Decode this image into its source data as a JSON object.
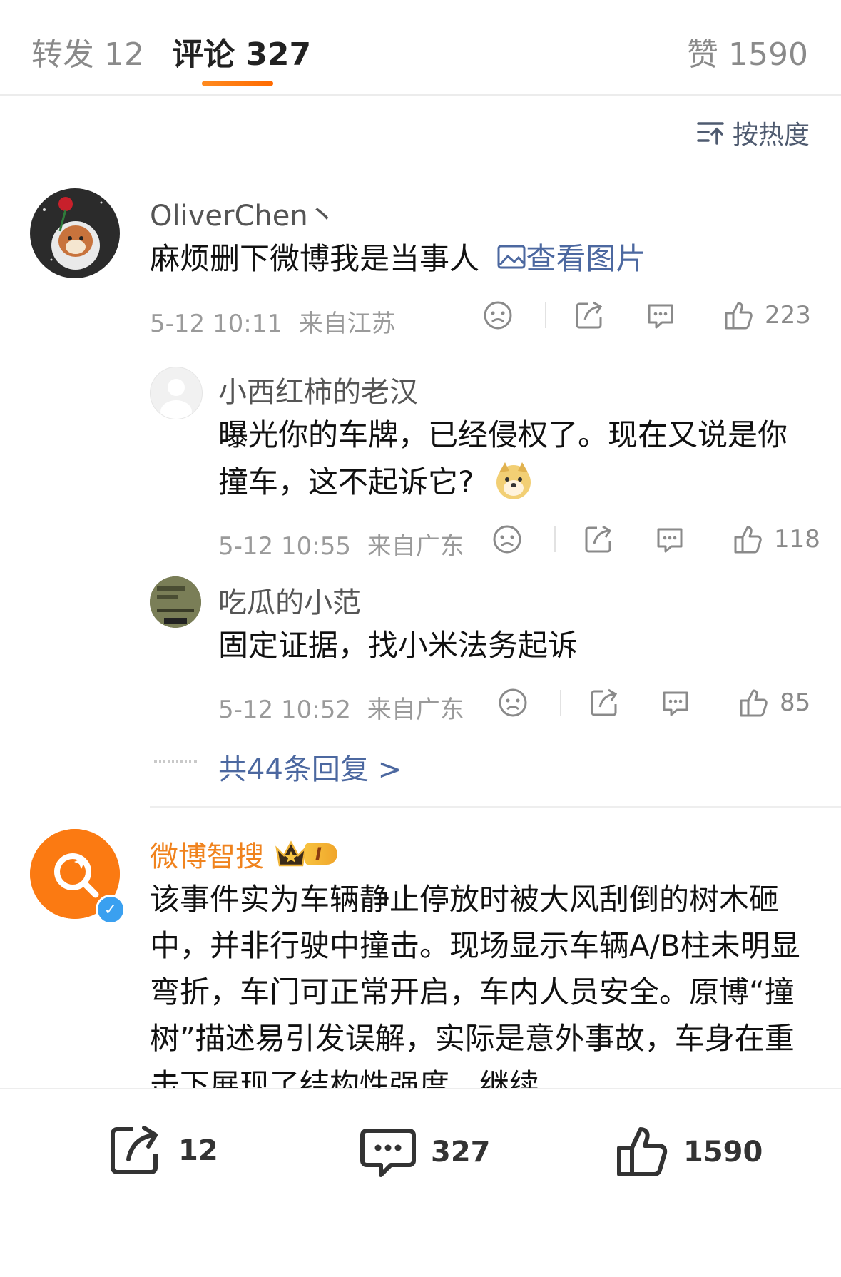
{
  "tabs": {
    "repost": "转发 12",
    "comment": "评论 327",
    "likes": "赞 1590"
  },
  "sort": {
    "label": "按热度"
  },
  "comments": [
    {
      "user": "OliverChen丶",
      "text": "麻烦删下微博我是当事人",
      "image_link": "查看图片",
      "time": "5-12 10:11",
      "location": "来自江苏",
      "likes": "223"
    }
  ],
  "replies": [
    {
      "user": "小西红柿的老汉",
      "text": "曝光你的车牌，已经侵权了。现在又说是你撞车，这不起诉它?",
      "time": "5-12 10:55",
      "location": "来自广东",
      "likes": "118"
    },
    {
      "user": "吃瓜的小范",
      "text": "固定证据，找小米法务起诉",
      "time": "5-12 10:52",
      "location": "来自广东",
      "likes": "85"
    }
  ],
  "more_replies": "共44条回复 >",
  "ai_comment": {
    "user": "微博智搜",
    "badge": "I",
    "text": "该事件实为车辆静止停放时被大风刮倒的树木砸中，并非行驶中撞击。现场显示车辆A/B柱未明显弯折，车门可正常开启，车内人员安全。原博“撞树”描述易引发误解，实际是意外事故，车身在重击下展现了结构性强度，继续"
  },
  "bottom_bar": {
    "repost_count": "12",
    "comment_count": "327",
    "like_count": "1590"
  },
  "colors": {
    "accent": "#ff8200",
    "link": "#4c68a0",
    "ai_name": "#f0831e"
  }
}
